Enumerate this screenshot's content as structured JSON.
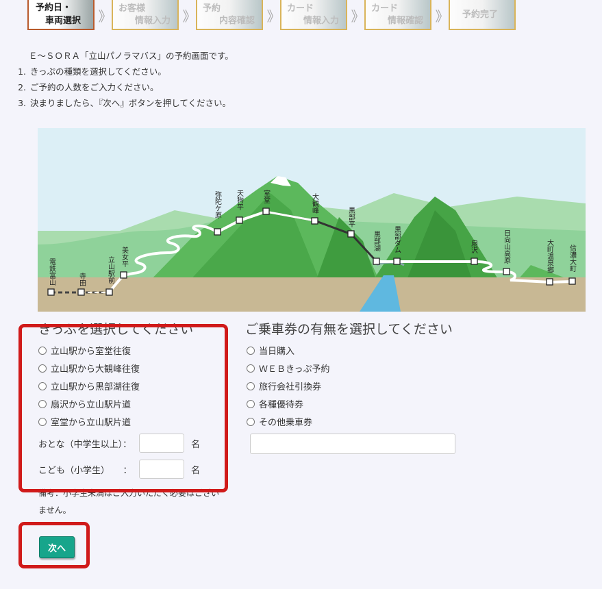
{
  "steps": [
    {
      "l1": "予約日・",
      "l2": "車両選択",
      "active": true
    },
    {
      "l1": "お客様",
      "l2": "情報入力"
    },
    {
      "l1": "予約",
      "l2": "内容確認"
    },
    {
      "l1": "カード",
      "l2": "情報入力"
    },
    {
      "l1": "カード",
      "l2": "情報確認"
    },
    {
      "l1": "予約完了",
      "l2": ""
    }
  ],
  "chevron": "》",
  "intro": {
    "lead": "Ｅ～ＳＯＲＡ「立山パノラマバス」の予約画面です。",
    "items": [
      "きっぷの種類を選択してください。",
      "ご予約の人数をご入力ください。",
      "決まりましたら、『次へ』ボタンを押してください。"
    ]
  },
  "map": {
    "stations": [
      "電鉄富山",
      "寺田",
      "立山駅前",
      "美女平",
      "弥陀ケ原",
      "天狗平",
      "室堂",
      "大観峰",
      "黒部平",
      "黒部湖",
      "黒部ダム",
      "扇沢",
      "日向山高原",
      "大町温泉郷",
      "信濃大町"
    ]
  },
  "ticket": {
    "title": "きっぷを選択してください",
    "options": [
      "立山駅から室堂往復",
      "立山駅から大観峰往復",
      "立山駅から黒部湖往復",
      "扇沢から立山駅片道",
      "室堂から立山駅片道"
    ],
    "adult_label": "おとな（中学生以上）：",
    "child_label": "こども（小学生）　　：",
    "unit": "名",
    "note": "備考：小学生未満はご入力いただく必要はございません。"
  },
  "ride": {
    "title": "ご乗車券の有無を選択してください",
    "options": [
      "当日購入",
      "ＷＥＢきっぷ予約",
      "旅行会社引換券",
      "各種優待券",
      "その他乗車券"
    ]
  },
  "next_label": "次へ",
  "colors": {
    "accent": "#17a58b",
    "highlight": "#d01a1a"
  }
}
